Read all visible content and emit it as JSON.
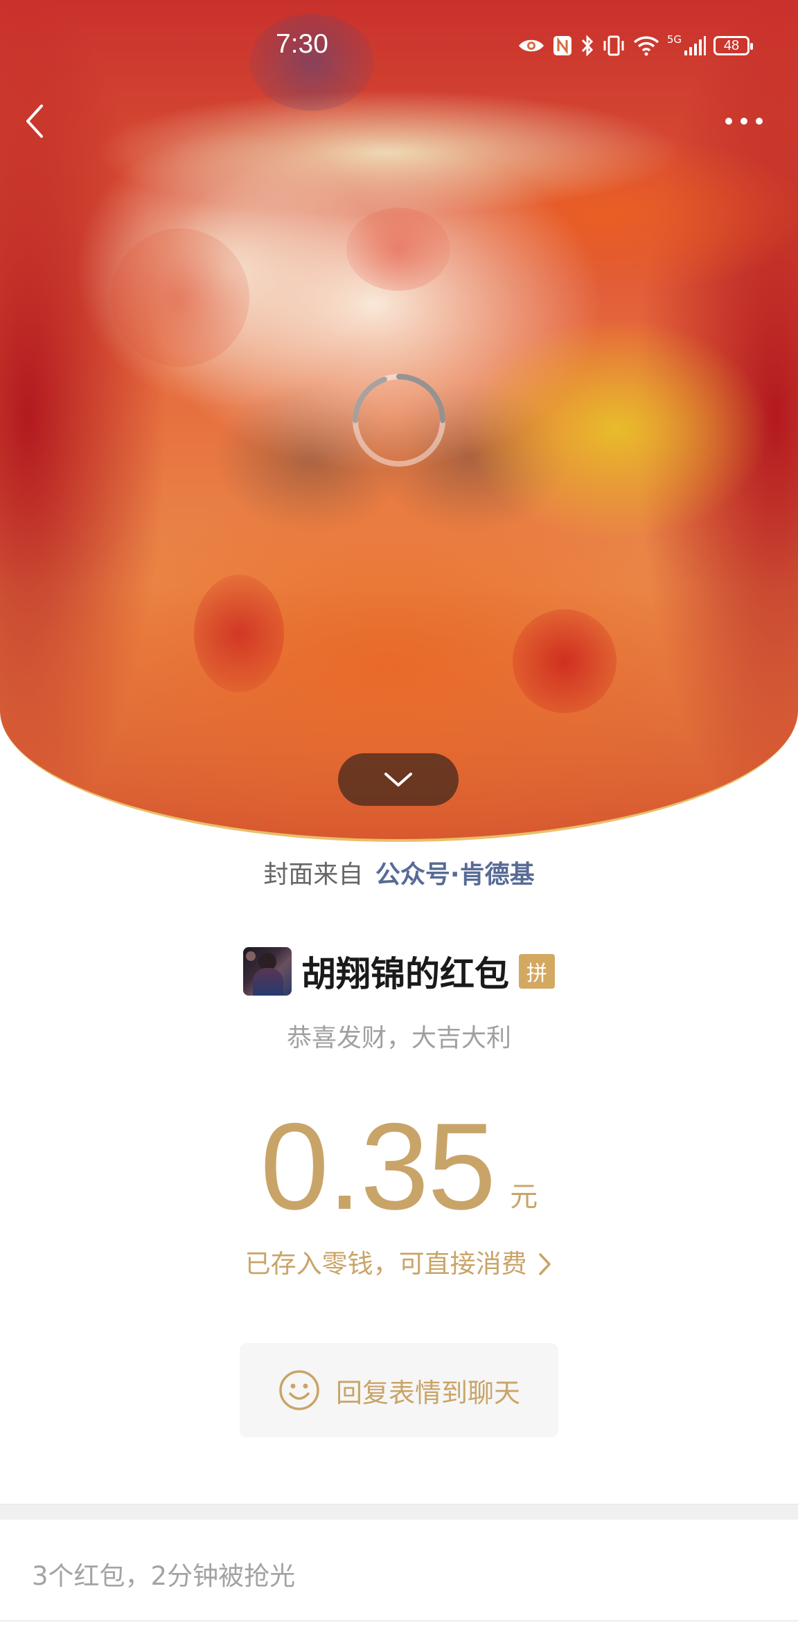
{
  "status_bar": {
    "time": "7:30",
    "battery": "48",
    "network": "5G",
    "icons": [
      "eye-icon",
      "nfc-icon",
      "bluetooth-icon",
      "vibrate-icon",
      "wifi-icon",
      "signal-icon",
      "battery-icon"
    ]
  },
  "header": {
    "back_icon": "chevron-left-icon",
    "more_icon": "more-dots-icon",
    "loading_icon": "loading-spinner-icon",
    "collapse_icon": "chevron-down-icon"
  },
  "cover": {
    "prefix": "封面来自",
    "source": "公众号·肯德基"
  },
  "packet": {
    "sender": "胡翔锦的红包",
    "type_badge": "拼",
    "greeting": "恭喜发财，大吉大利",
    "amount": "0.35",
    "unit": "元",
    "saved_note": "已存入零钱，可直接消费"
  },
  "reply": {
    "label": "回复表情到聊天",
    "icon": "smiley-icon"
  },
  "summary": "3个红包，2分钟被抢光",
  "colors": {
    "gold": "#c9a468",
    "link_blue": "#576b95",
    "badge_gold": "#d3a860",
    "curve_border": "#e8bf6a"
  }
}
